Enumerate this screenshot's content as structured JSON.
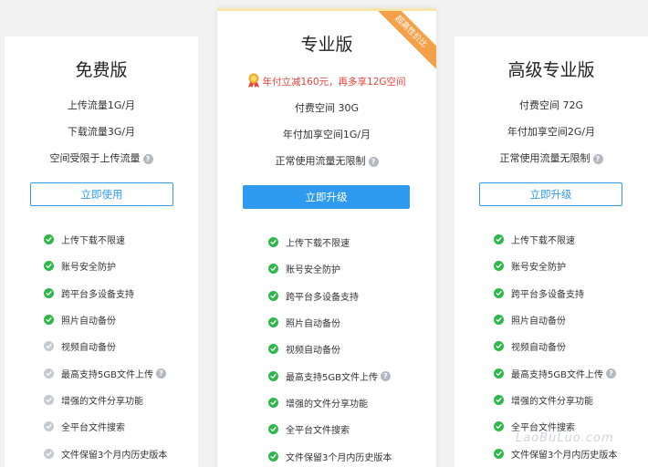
{
  "plans": [
    {
      "name": "免费版",
      "info": [
        "上传流量1G/月",
        "下载流量3G/月",
        "空间受限于上传流量"
      ],
      "button": "立即使用",
      "features": [
        {
          "label": "上传下载不限速",
          "enabled": true
        },
        {
          "label": "账号安全防护",
          "enabled": true
        },
        {
          "label": "跨平台多设备支持",
          "enabled": true
        },
        {
          "label": "照片自动备份",
          "enabled": true
        },
        {
          "label": "视频自动备份",
          "enabled": false
        },
        {
          "label": "最高支持5GB文件上传",
          "enabled": false
        },
        {
          "label": "增强的文件分享功能",
          "enabled": false
        },
        {
          "label": "全平台文件搜索",
          "enabled": false
        },
        {
          "label": "文件保留3个月内历史版本",
          "enabled": false
        }
      ]
    },
    {
      "name": "专业版",
      "ribbon": "超高性价比",
      "promo": "年付立减160元，再多享12G空间",
      "info": [
        "付费空间 30G",
        "年付加享空间1G/月",
        "正常使用流量无限制"
      ],
      "button": "立即升级",
      "features": [
        {
          "label": "上传下载不限速",
          "enabled": true
        },
        {
          "label": "账号安全防护",
          "enabled": true
        },
        {
          "label": "跨平台多设备支持",
          "enabled": true
        },
        {
          "label": "照片自动备份",
          "enabled": true
        },
        {
          "label": "视频自动备份",
          "enabled": true
        },
        {
          "label": "最高支持5GB文件上传",
          "enabled": true
        },
        {
          "label": "增强的文件分享功能",
          "enabled": true
        },
        {
          "label": "全平台文件搜索",
          "enabled": true
        },
        {
          "label": "文件保留3个月内历史版本",
          "enabled": true
        }
      ]
    },
    {
      "name": "高级专业版",
      "info": [
        "付费空间 72G",
        "年付加享空间2G/月",
        "正常使用流量无限制"
      ],
      "button": "立即升级",
      "features": [
        {
          "label": "上传下载不限速",
          "enabled": true
        },
        {
          "label": "账号安全防护",
          "enabled": true
        },
        {
          "label": "跨平台多设备支持",
          "enabled": true
        },
        {
          "label": "照片自动备份",
          "enabled": true
        },
        {
          "label": "视频自动备份",
          "enabled": true
        },
        {
          "label": "最高支持5GB文件上传",
          "enabled": true
        },
        {
          "label": "增强的文件分享功能",
          "enabled": true
        },
        {
          "label": "全平台文件搜索",
          "enabled": true
        },
        {
          "label": "文件保留3个月内历史版本",
          "enabled": true
        }
      ]
    }
  ],
  "watermark": "LaoBuLuo.com",
  "icons": {
    "help": "help-circle-icon",
    "check": "check-circle-icon",
    "promo": "medal-icon"
  },
  "colors": {
    "accent": "#2f9bf0",
    "check_on": "#2fb84a",
    "check_off": "#c4cad2",
    "promo": "#e8423a",
    "ribbon": "#f5a14a"
  }
}
